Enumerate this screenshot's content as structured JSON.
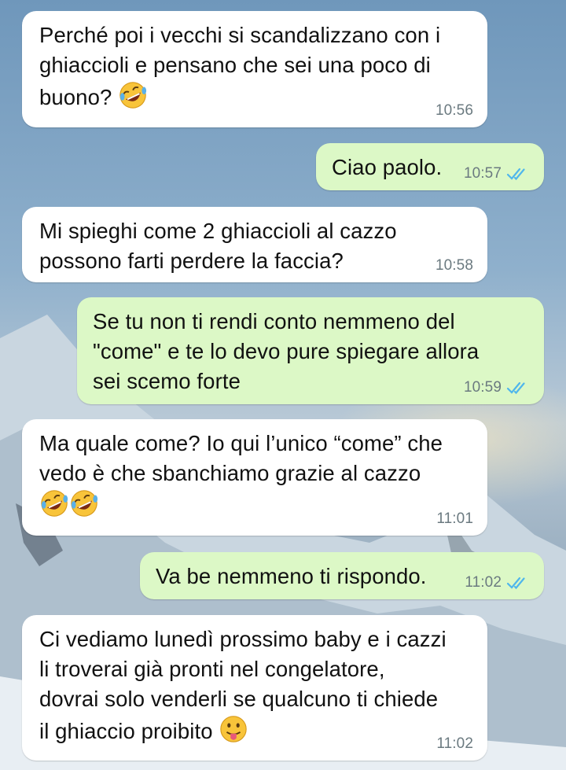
{
  "messages": [
    {
      "direction": "in",
      "text_lines": [
        "Perché poi i vecchi si scandalizzano con i",
        "ghiaccioli e pensano che sei una poco di",
        "buono?"
      ],
      "emoji": [
        "rolling-on-floor-laughing"
      ],
      "time": "10:56"
    },
    {
      "direction": "out",
      "text_lines": [
        "Ciao paolo."
      ],
      "time": "10:57",
      "read_ticks": "double-check-blue"
    },
    {
      "direction": "in",
      "text_lines": [
        "Mi spieghi come 2 ghiaccioli al cazzo",
        "possono farti perdere la faccia?"
      ],
      "time": "10:58"
    },
    {
      "direction": "out",
      "text_lines": [
        "Se tu non ti rendi conto nemmeno del",
        "\"come\" e te lo devo pure spiegare allora",
        "sei scemo forte"
      ],
      "time": "10:59",
      "read_ticks": "double-check-blue"
    },
    {
      "direction": "in",
      "text_lines": [
        "Ma quale come? Io qui l’unico “come” che",
        "vedo è che sbanchiamo grazie al cazzo"
      ],
      "emoji": [
        "rolling-on-floor-laughing",
        "rolling-on-floor-laughing"
      ],
      "time": "11:01"
    },
    {
      "direction": "out",
      "text_lines": [
        "Va be nemmeno ti rispondo."
      ],
      "time": "11:02",
      "read_ticks": "double-check-blue"
    },
    {
      "direction": "in",
      "text_lines": [
        "Ci vediamo lunedì prossimo baby e i cazzi",
        "li troverai già pronti nel congelatore,",
        "dovrai solo venderli se qualcuno ti chiede",
        "il ghiaccio proibito"
      ],
      "emoji": [
        "face-with-tongue"
      ],
      "time": "11:02"
    }
  ],
  "colors": {
    "incoming_bubble": "#ffffff",
    "outgoing_bubble": "#dcf8c6",
    "timestamp": "#6b7a80",
    "read_tick": "#4fb6ec"
  }
}
